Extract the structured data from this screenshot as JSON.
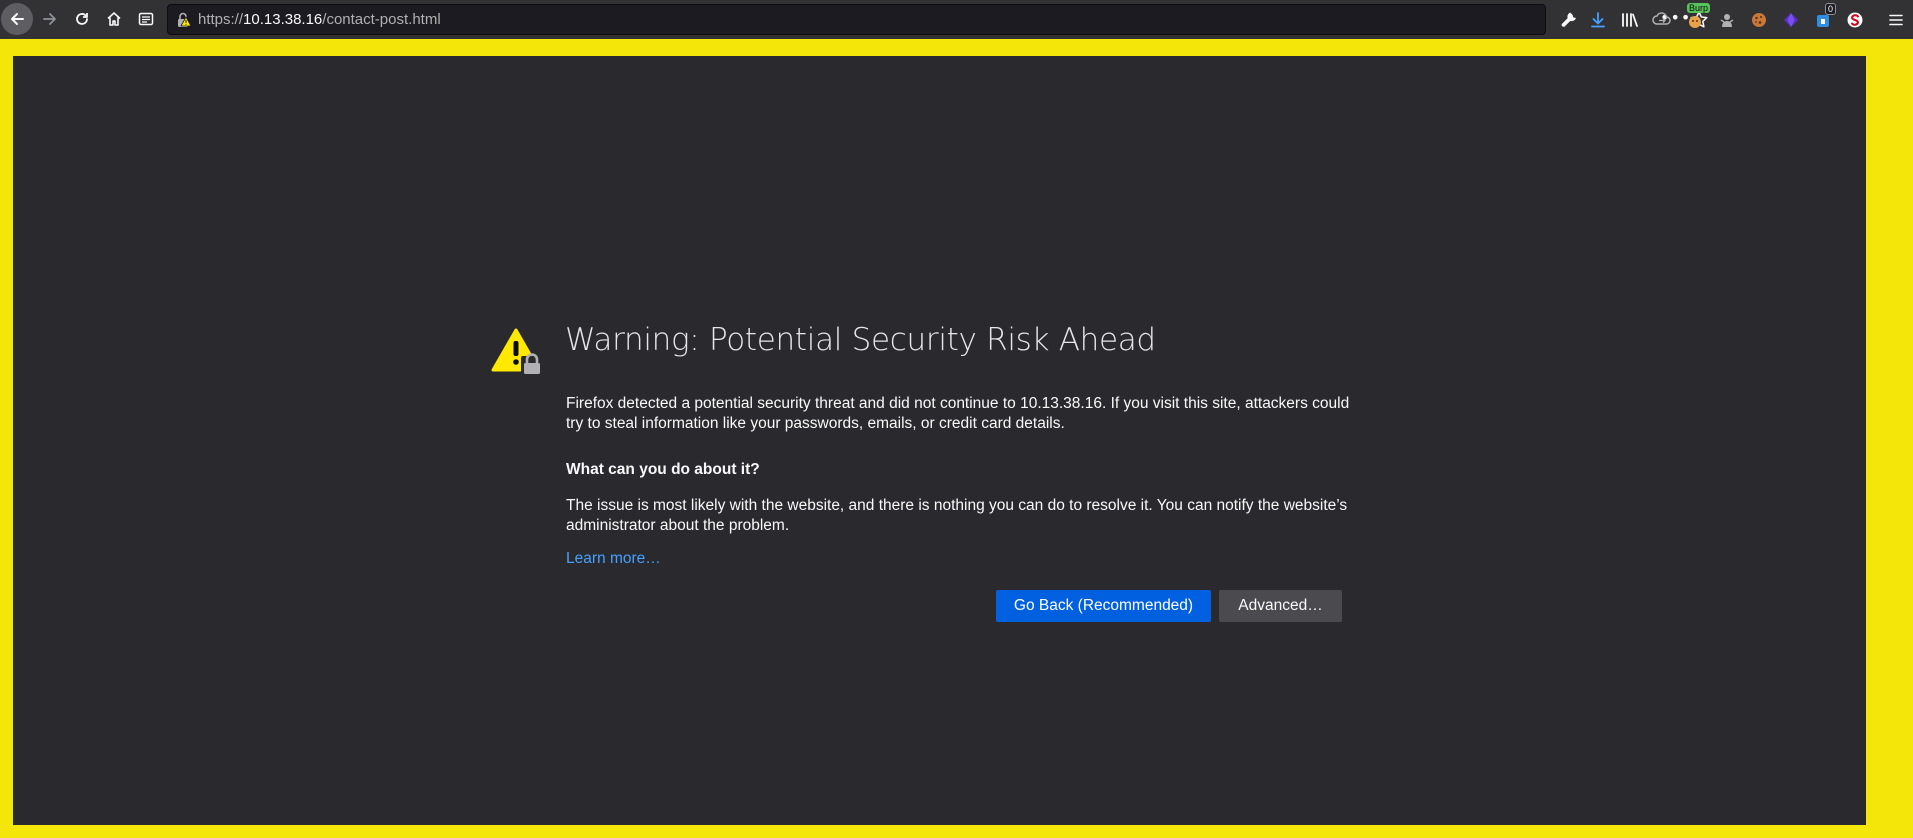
{
  "toolbar": {
    "url_scheme": "https://",
    "url_host": "10.13.38.16",
    "url_path": "/contact-post.html",
    "url_overflow": "•••",
    "burp_badge": "Burp",
    "count_badge": "0"
  },
  "error_page": {
    "title": "Warning: Potential Security Risk Ahead",
    "description": "Firefox detected a potential security threat and did not continue to 10.13.38.16. If you visit this site, attackers could try to steal information like your passwords, emails, or credit card details.",
    "subheading": "What can you do about it?",
    "explanation": "The issue is most likely with the website, and there is nothing you can do to resolve it. You can notify the website’s administrator about the problem.",
    "learn_more": "Learn more…",
    "go_back_label": "Go Back (Recommended)",
    "advanced_label": "Advanced…"
  },
  "colors": {
    "frame": "#f5e60a",
    "page_bg": "#2a2a2e",
    "primary_button": "#0060df",
    "link": "#45a1ff",
    "warning": "#ffe900"
  },
  "icons": [
    "back-arrow-icon",
    "forward-arrow-icon",
    "reload-icon",
    "home-icon",
    "reader-view-icon",
    "warning-lock-icon",
    "star-icon",
    "wrench-icon",
    "download-icon",
    "library-icon",
    "sync-icon",
    "burp-extension-icon",
    "puppet-extension-icon",
    "cookie-extension-icon",
    "gem-extension-icon",
    "addon-icon",
    "selenium-icon",
    "hamburger-menu-icon",
    "security-warning-icon"
  ]
}
